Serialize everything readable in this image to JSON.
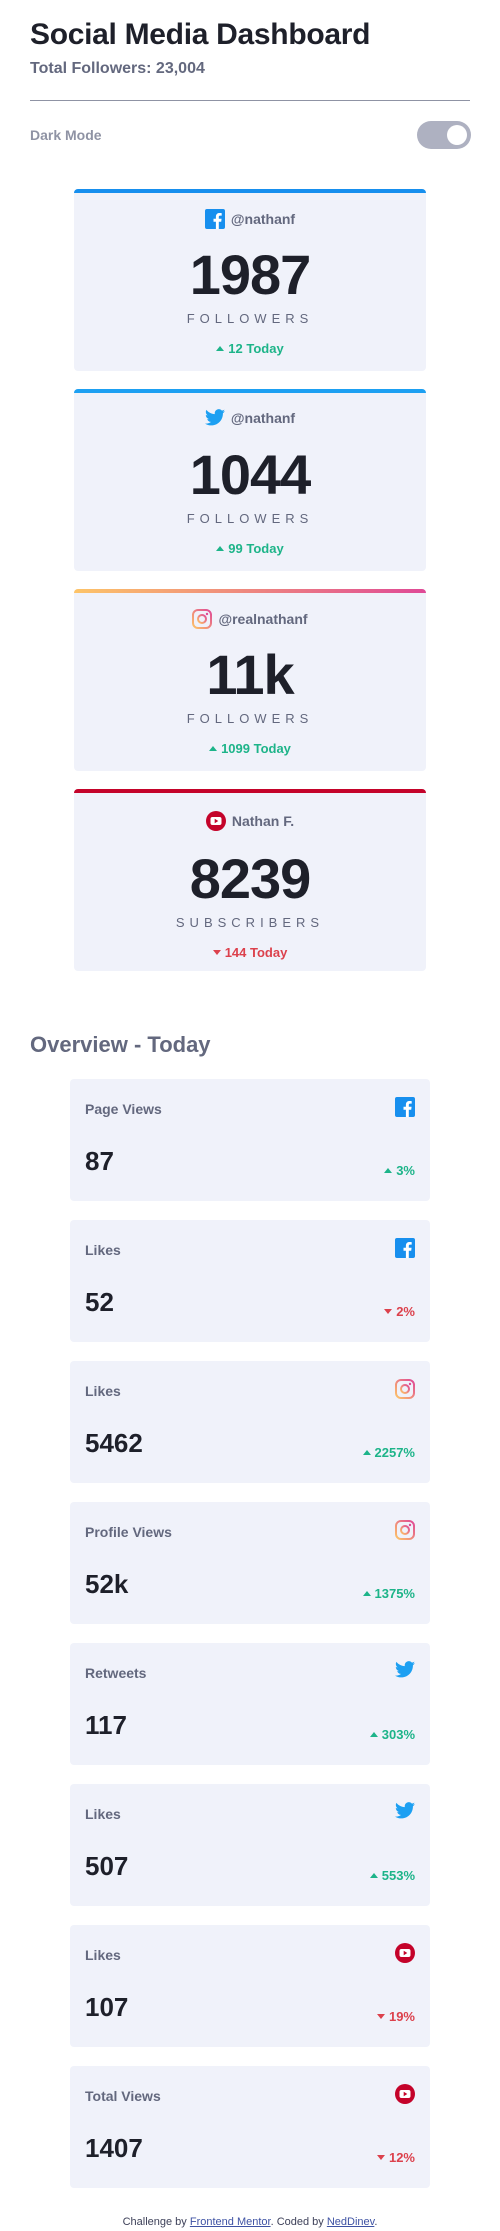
{
  "header": {
    "title": "Social Media Dashboard",
    "total_followers": "Total Followers: 23,004"
  },
  "theme_toggle": {
    "label": "Dark Mode",
    "state": "off"
  },
  "colors": {
    "facebook": "#178fee",
    "twitter": "#1da0f2",
    "instagram_start": "#fdc468",
    "instagram_end": "#df4996",
    "youtube": "#c4032a",
    "up": "#1db489",
    "down": "#dc414c"
  },
  "follower_cards": [
    {
      "platform_icon": "facebook-icon",
      "handle": "@nathanf",
      "count": "1987",
      "unit": "FOLLOWERS",
      "change": "12 Today",
      "direction": "up"
    },
    {
      "platform_icon": "twitter-icon",
      "handle": "@nathanf",
      "count": "1044",
      "unit": "FOLLOWERS",
      "change": "99 Today",
      "direction": "up"
    },
    {
      "platform_icon": "instagram-icon",
      "handle": "@realnathanf",
      "count": "11k",
      "unit": "FOLLOWERS",
      "change": "1099 Today",
      "direction": "up"
    },
    {
      "platform_icon": "youtube-icon",
      "handle": "Nathan F.",
      "count": "8239",
      "unit": "SUBSCRIBERS",
      "change": "144 Today",
      "direction": "down"
    }
  ],
  "overview": {
    "title": "Overview - Today",
    "cards": [
      {
        "label": "Page Views",
        "platform_icon": "facebook-icon",
        "value": "87",
        "change": "3%",
        "direction": "up"
      },
      {
        "label": "Likes",
        "platform_icon": "facebook-icon",
        "value": "52",
        "change": "2%",
        "direction": "down"
      },
      {
        "label": "Likes",
        "platform_icon": "instagram-icon",
        "value": "5462",
        "change": "2257%",
        "direction": "up"
      },
      {
        "label": "Profile Views",
        "platform_icon": "instagram-icon",
        "value": "52k",
        "change": "1375%",
        "direction": "up"
      },
      {
        "label": "Retweets",
        "platform_icon": "twitter-icon",
        "value": "117",
        "change": "303%",
        "direction": "up"
      },
      {
        "label": "Likes",
        "platform_icon": "twitter-icon",
        "value": "507",
        "change": "553%",
        "direction": "up"
      },
      {
        "label": "Likes",
        "platform_icon": "youtube-icon",
        "value": "107",
        "change": "19%",
        "direction": "down"
      },
      {
        "label": "Total Views",
        "platform_icon": "youtube-icon",
        "value": "1407",
        "change": "12%",
        "direction": "down"
      }
    ]
  },
  "footer": {
    "prefix": "Challenge by ",
    "link1": "Frontend Mentor",
    "middle": ". Coded by ",
    "link2": "NedDinev",
    "suffix": "."
  }
}
